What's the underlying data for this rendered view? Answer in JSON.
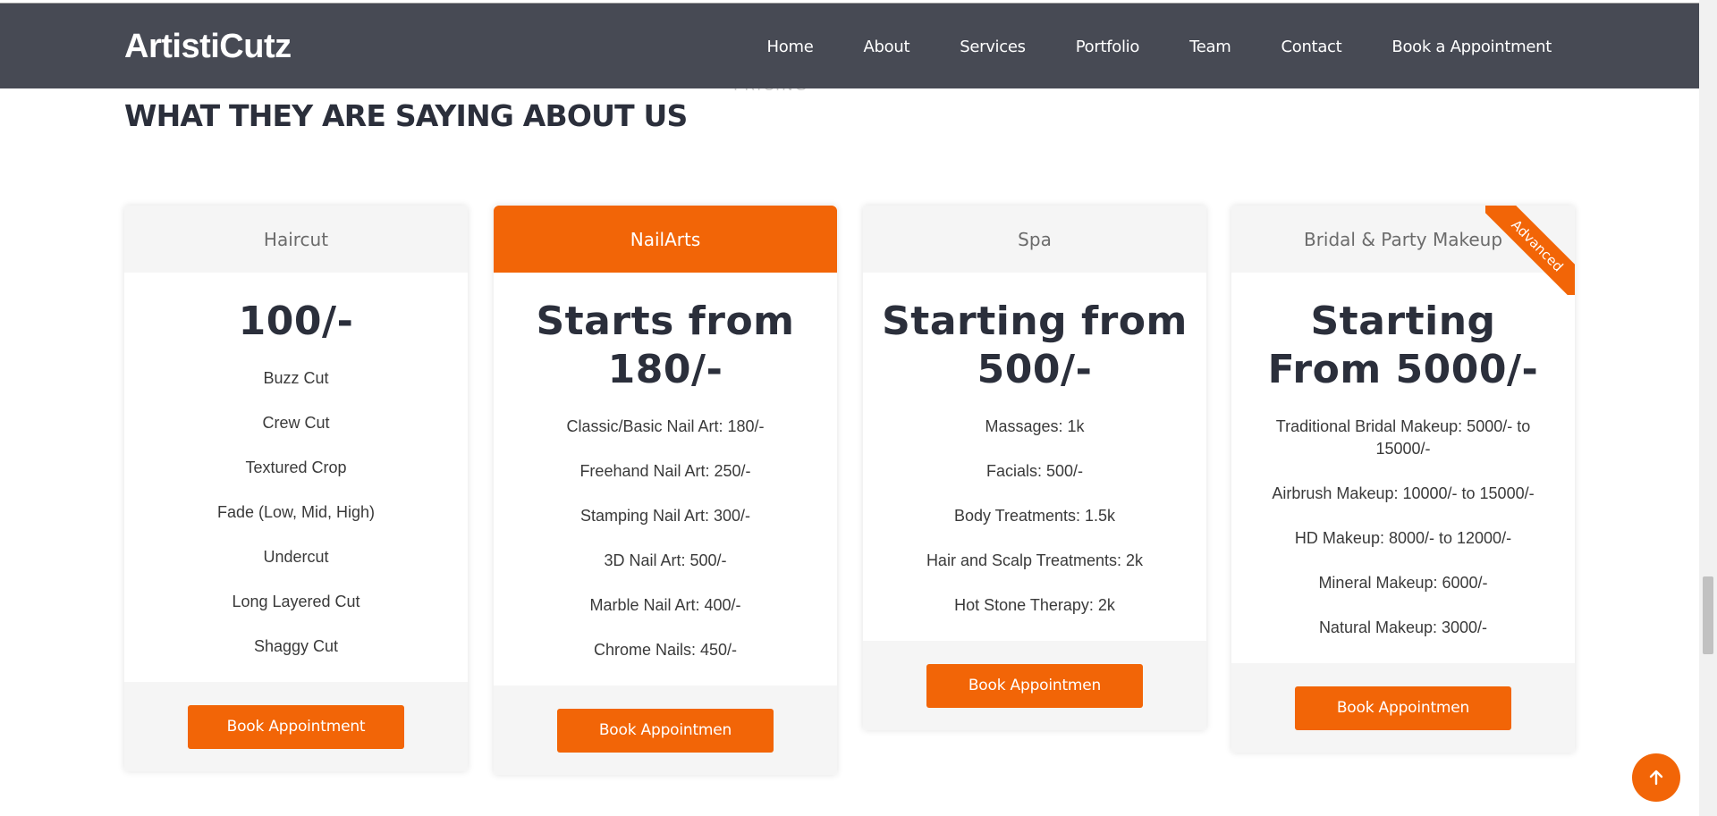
{
  "header": {
    "logo": "ArtistiCutz",
    "nav": [
      "Home",
      "About",
      "Services",
      "Portfolio",
      "Team",
      "Contact",
      "Book a Appointment"
    ]
  },
  "ghost_label": "PRICING",
  "section_title": "WHAT THEY ARE SAYING ABOUT US",
  "accent_color": "#f26507",
  "header_color": "#474a54",
  "cards": [
    {
      "name": "Haircut",
      "price": "100/-",
      "features": [
        "Buzz Cut",
        "Crew Cut",
        "Textured Crop",
        "Fade (Low, Mid, High)",
        "Undercut",
        "Long Layered Cut",
        "Shaggy Cut"
      ],
      "button": "Book Appointment"
    },
    {
      "name": "NailArts",
      "price": "Starts from 180/-",
      "features": [
        "Classic/Basic Nail Art: 180/-",
        "Freehand Nail Art: 250/-",
        "Stamping Nail Art: 300/-",
        "3D Nail Art: 500/-",
        "Marble Nail Art: 400/-",
        "Chrome Nails: 450/-"
      ],
      "button": "Book Appointmen"
    },
    {
      "name": "Spa",
      "price": "Starting from 500/-",
      "features": [
        "Massages: 1k",
        "Facials: 500/-",
        "Body Treatments: 1.5k",
        "Hair and Scalp Treatments: 2k",
        "Hot Stone Therapy: 2k"
      ],
      "button": "Book Appointmen"
    },
    {
      "name": "Bridal & Party Makeup",
      "price": "Starting From 5000/-",
      "ribbon": "Advanced",
      "features": [
        "Traditional Bridal Makeup: 5000/- to 15000/-",
        "Airbrush Makeup: 10000/- to 15000/-",
        "HD Makeup: 8000/- to 12000/-",
        "Mineral Makeup: 6000/-",
        "Natural Makeup: 3000/-"
      ],
      "button": "Book Appointmen"
    }
  ],
  "icons": {
    "back_to_top": "arrow-up-icon"
  }
}
